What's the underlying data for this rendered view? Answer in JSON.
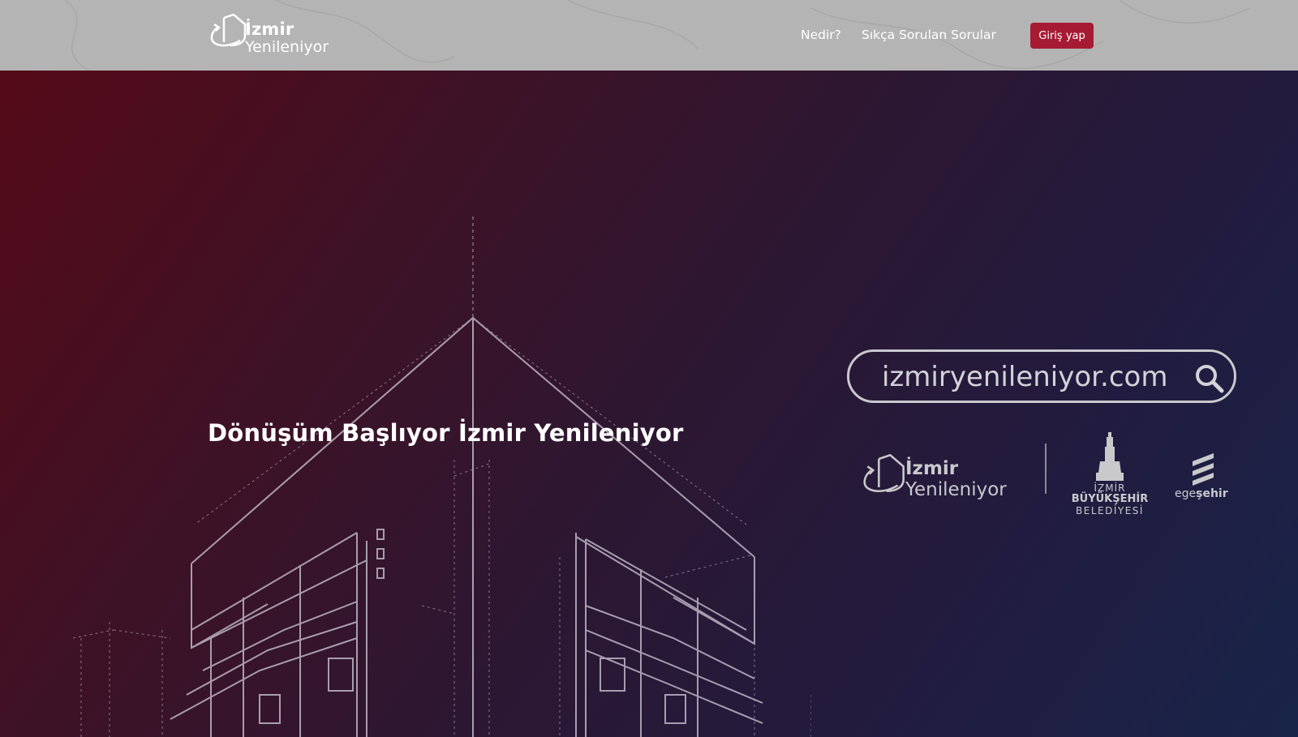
{
  "header": {
    "logo": {
      "line1": "İzmir",
      "line2": "Yenileniyor"
    },
    "nav": [
      {
        "label": "Nedir?"
      },
      {
        "label": "Sıkça Sorulan Sorular"
      }
    ],
    "login_label": "Giriş yap"
  },
  "hero": {
    "title": "Dönüşüm Başlıyor İzmir Yenileniyor",
    "search": {
      "placeholder": "izmiryenileniyor.com",
      "value": ""
    },
    "partners": {
      "project_logo": {
        "line1": "İzmir",
        "line2": "Yenileniyor"
      },
      "municipality_logo": {
        "line1": "İZMİR",
        "line2": "BÜYÜKŞEHİR",
        "line3": "BELEDİYESİ"
      },
      "egesehir_logo": {
        "prefix": "ege",
        "suffix": "şehir"
      }
    }
  },
  "colors": {
    "header_bg": "#b4b4b4",
    "accent": "#a61b33",
    "hero_gradient_start": "#550a18",
    "hero_gradient_end": "#182449",
    "outline": "#c9c9cf"
  },
  "icons": [
    "house-arrow-logo-icon",
    "search-icon",
    "clock-tower-icon",
    "egesehir-stripes-icon"
  ]
}
